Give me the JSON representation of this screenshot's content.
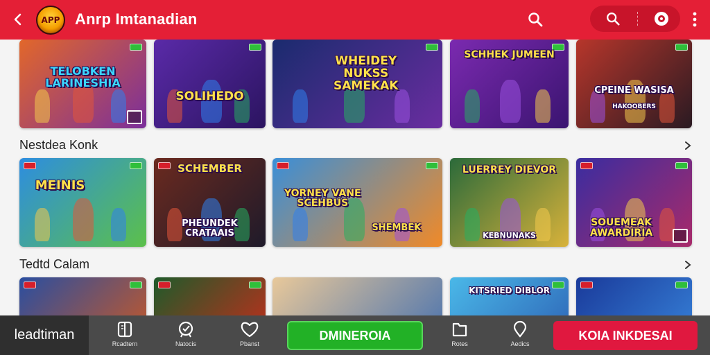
{
  "header": {
    "logo_text": "APP",
    "title": "Anrp Imtanadian",
    "icons": [
      "back-arrow-icon",
      "search-icon",
      "search-icon",
      "target-icon",
      "more-vert-icon"
    ]
  },
  "sections": [
    {
      "title": "",
      "cards": [
        {
          "title": "TELOBKEN LARINESHIA",
          "subtitle": "",
          "bg": "#e2672a",
          "bg2": "#7b2f9b"
        },
        {
          "title": "",
          "subtitle": "SOLIHEDO",
          "bg": "#5a2aa8",
          "bg2": "#2b1460"
        },
        {
          "title": "WHEIDEY NUKSS SAMEKAK",
          "subtitle": "",
          "bg": "#1a2b6e",
          "bg2": "#6a2da0"
        },
        {
          "title": "SCHHEK JUMEEN",
          "subtitle": "",
          "bg": "#7b2ab0",
          "bg2": "#3a1470"
        },
        {
          "title": "CPEINE WASISA",
          "subtitle": "HAKOOBERS",
          "bg": "#b7362b",
          "bg2": "#2a1a22"
        }
      ]
    },
    {
      "title": "Nestdea Konk",
      "cards": [
        {
          "title": "MEINIS",
          "subtitle": "",
          "bg": "#2d8de0",
          "bg2": "#5cc04a"
        },
        {
          "title": "SCHEMBER",
          "subtitle": "PHEUNDEK CRATAAIS",
          "bg": "#6b2a1f",
          "bg2": "#1e1a2a"
        },
        {
          "title": "YORNEY VANE SCEHBUS",
          "subtitle": "SHEMBEK",
          "bg": "#3a8fd8",
          "bg2": "#f08a28"
        },
        {
          "title": "LUERREY DIEVOR",
          "subtitle": "KEBNUNAKS",
          "bg": "#2b6a3a",
          "bg2": "#d8b23a"
        },
        {
          "title": "",
          "subtitle": "SOUEMEAK AWARDIRIA",
          "bg": "#3a2da0",
          "bg2": "#a82a6a"
        }
      ]
    },
    {
      "title": "Tedtd Calam",
      "cards": [
        {
          "title": "",
          "subtitle": "",
          "bg": "#2a4ea0",
          "bg2": "#d85a1a"
        },
        {
          "title": "",
          "subtitle": "",
          "bg": "#1f5a2a",
          "bg2": "#d8281a"
        },
        {
          "title": "",
          "subtitle": "",
          "bg": "#e8c89a",
          "bg2": "#3a6ab0"
        },
        {
          "title": "KITSRIED DIBLOR",
          "subtitle": "",
          "bg": "#4ab8e8",
          "bg2": "#2a5ab0"
        },
        {
          "title": "",
          "subtitle": "",
          "bg": "#1a3a9a",
          "bg2": "#3a8ae0"
        }
      ]
    }
  ],
  "bottom_bar": {
    "left_label": "leadtiman",
    "items": [
      {
        "label": "Rcadtern",
        "icon": "book-icon"
      },
      {
        "label": "Natocis",
        "icon": "shield-check-icon"
      },
      {
        "label": "Pbanst",
        "icon": "heart-icon"
      },
      {
        "label": "Rotes",
        "icon": "folder-icon"
      },
      {
        "label": "Aedics",
        "icon": "location-pin-icon"
      }
    ],
    "primary_button": "DMINEROIA",
    "secondary_button": "KOIA INKDESAI"
  },
  "colors": {
    "header": "#e41f36",
    "bottom_bar": "#4a4a4a",
    "primary": "#22b126",
    "secondary": "#e0183f"
  }
}
